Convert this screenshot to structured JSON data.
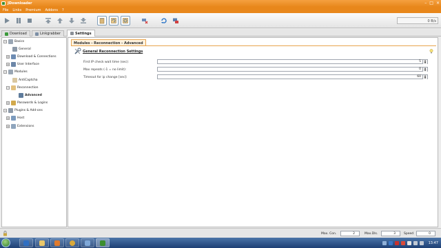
{
  "window": {
    "title": "JDownloader"
  },
  "menu": [
    "File",
    "Links",
    "Premium",
    "Addons",
    "?"
  ],
  "toolbar": {
    "speed_text": "0 B/s"
  },
  "tabs": [
    {
      "label": "Download"
    },
    {
      "label": "Linkgrabber"
    },
    {
      "label": "Settings"
    }
  ],
  "sidebar": {
    "items": [
      {
        "label": "Basics"
      },
      {
        "label": "General"
      },
      {
        "label": "Download & Connections"
      },
      {
        "label": "User Interface"
      },
      {
        "label": "Modules"
      },
      {
        "label": "AntiCaptcha"
      },
      {
        "label": "Reconnection"
      },
      {
        "label": "Advanced"
      },
      {
        "label": "Passwords & Logins"
      },
      {
        "label": "Plugins & Add-ons"
      },
      {
        "label": "Host"
      },
      {
        "label": "Extensions"
      }
    ]
  },
  "content": {
    "tab_label": "Modules - Reconnection - Advanced",
    "section_title": "General Reconnection Settings",
    "fields": [
      {
        "label": "First IP check wait time (sec):",
        "value": "5"
      },
      {
        "label": "Max repeats (-1 = no limit):",
        "value": "0"
      },
      {
        "label": "Timeout for ip change [sec]:",
        "value": "60"
      }
    ]
  },
  "statusbar": {
    "max_con_label": "Max. Con.",
    "max_con_value": "2",
    "max_dls_label": "Max.Dls.",
    "max_dls_value": "3",
    "speed_label": "Speed",
    "speed_value": "0"
  },
  "taskbar": {
    "clock": "13:47"
  },
  "colors": {
    "accent": "#E8871B",
    "tab_highlight": "#E8A34C",
    "taskbar": "#1D3F74"
  }
}
